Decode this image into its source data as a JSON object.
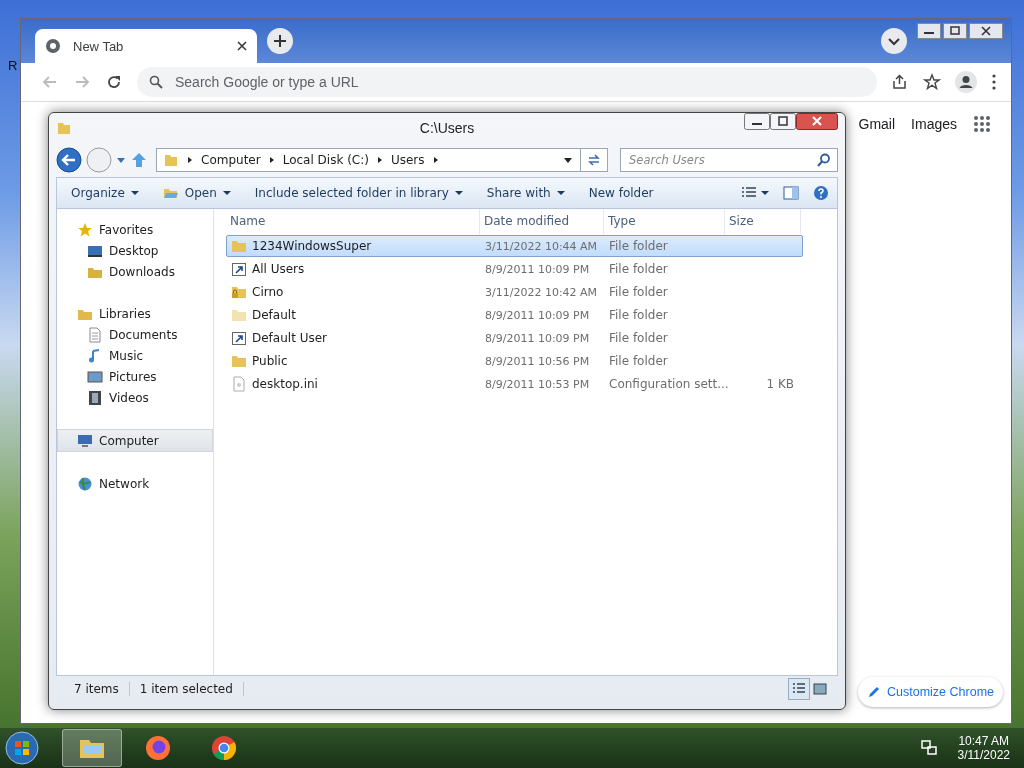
{
  "desktop": {
    "icon_label": "R"
  },
  "browser": {
    "tabs": [
      {
        "title": "New Tab",
        "selected": true
      }
    ],
    "omnibox": {
      "placeholder": "Search Google or type a URL"
    },
    "links": [
      "Gmail",
      "Images"
    ],
    "customize_button": "Customize Chrome"
  },
  "explorer": {
    "title": "C:\\Users",
    "breadcrumb": [
      "Computer",
      "Local Disk (C:)",
      "Users"
    ],
    "search": {
      "placeholder": "Search Users"
    },
    "toolbar": [
      {
        "label": "Organize",
        "kind": "menu"
      },
      {
        "label": "Open",
        "kind": "open"
      },
      {
        "label": "Include selected folder in library",
        "kind": "menu"
      },
      {
        "label": "Share with",
        "kind": "menu"
      },
      {
        "label": "New folder",
        "kind": "plain"
      }
    ],
    "sidebar": [
      {
        "label": "Favorites",
        "kind": "star",
        "selected": false,
        "children": [
          {
            "label": "Desktop",
            "kind": "desktop",
            "selected": false
          },
          {
            "label": "Downloads",
            "kind": "downloads",
            "selected": false
          }
        ]
      },
      {
        "label": "Libraries",
        "kind": "library",
        "selected": false,
        "children": [
          {
            "label": "Documents",
            "kind": "document",
            "selected": false
          },
          {
            "label": "Music",
            "kind": "music",
            "selected": false
          },
          {
            "label": "Pictures",
            "kind": "picture",
            "selected": false
          },
          {
            "label": "Videos",
            "kind": "video",
            "selected": false
          }
        ]
      },
      {
        "label": "Computer",
        "kind": "computer",
        "selected": true
      },
      {
        "label": "Network",
        "kind": "network",
        "selected": false
      }
    ],
    "columns": [
      "Name",
      "Date modified",
      "Type",
      "Size"
    ],
    "rows": [
      {
        "name": "1234WindowsSuper",
        "kind": "folder",
        "date": "3/11/2022 10:44 AM",
        "type": "File folder",
        "selected": true
      },
      {
        "name": "All Users",
        "kind": "shortcut",
        "date": "8/9/2011 10:09 PM",
        "type": "File folder",
        "selected": false
      },
      {
        "name": "Cirno",
        "kind": "locked",
        "date": "3/11/2022 10:42 AM",
        "type": "File folder",
        "selected": false
      },
      {
        "name": "Default",
        "kind": "folder-faded",
        "date": "8/9/2011 10:09 PM",
        "type": "File folder",
        "selected": false
      },
      {
        "name": "Default User",
        "kind": "shortcut",
        "date": "8/9/2011 10:09 PM",
        "type": "File folder",
        "selected": false
      },
      {
        "name": "Public",
        "kind": "folder",
        "date": "8/9/2011 10:56 PM",
        "type": "File folder",
        "selected": false
      },
      {
        "name": "desktop.ini",
        "kind": "file",
        "date": "8/9/2011 10:53 PM",
        "type": "Configuration sett...",
        "size": "1 KB",
        "selected": false
      }
    ],
    "status": [
      "7 items",
      "1 item selected"
    ]
  },
  "taskbar": {
    "apps": [
      {
        "kind": "explorer",
        "active": true
      },
      {
        "kind": "firefox",
        "active": false
      },
      {
        "kind": "chrome",
        "active": false
      }
    ],
    "time": "10:47 AM",
    "date": "3/11/2022"
  }
}
